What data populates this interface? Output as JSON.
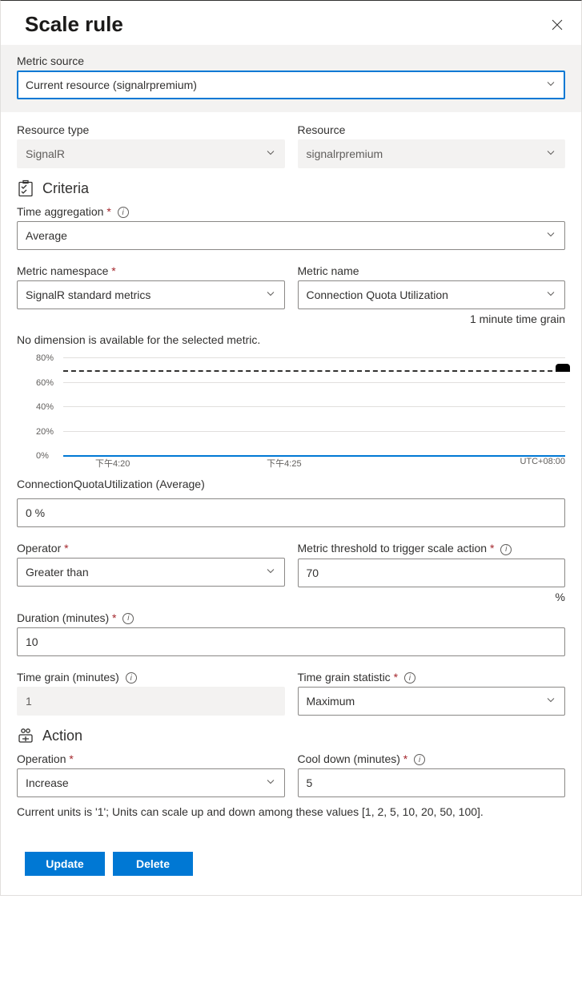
{
  "title": "Scale rule",
  "metric_source": {
    "label": "Metric source",
    "value": "Current resource (signalrpremium)"
  },
  "resource_type": {
    "label": "Resource type",
    "value": "SignalR"
  },
  "resource": {
    "label": "Resource",
    "value": "signalrpremium"
  },
  "criteria": {
    "title": "Criteria"
  },
  "time_aggregation": {
    "label": "Time aggregation",
    "value": "Average"
  },
  "metric_namespace": {
    "label": "Metric namespace",
    "value": "SignalR standard metrics"
  },
  "metric_name": {
    "label": "Metric name",
    "value": "Connection Quota Utilization",
    "grain_note": "1 minute time grain"
  },
  "dimension_note": "No dimension is available for the selected metric.",
  "chart_data": {
    "type": "line",
    "title": "",
    "ylabel": "",
    "ylim": [
      0,
      80
    ],
    "y_ticks": [
      "0%",
      "20%",
      "40%",
      "60%",
      "80%"
    ],
    "x_ticks": [
      "下午4:20",
      "下午4:25",
      "UTC+08:00"
    ],
    "threshold": 70,
    "series": [
      {
        "name": "ConnectionQuotaUtilization (Average)",
        "values": [
          0,
          0,
          0,
          0,
          0,
          0,
          0,
          0,
          0,
          0
        ]
      }
    ]
  },
  "chart_legend": "ConnectionQuotaUtilization (Average)",
  "current_value": {
    "value": "0 %"
  },
  "operator": {
    "label": "Operator",
    "value": "Greater than"
  },
  "threshold": {
    "label": "Metric threshold to trigger scale action",
    "value": "70",
    "unit": "%"
  },
  "duration": {
    "label": "Duration (minutes)",
    "value": "10"
  },
  "time_grain": {
    "label": "Time grain (minutes)",
    "value": "1"
  },
  "time_grain_stat": {
    "label": "Time grain statistic",
    "value": "Maximum"
  },
  "action": {
    "title": "Action"
  },
  "operation": {
    "label": "Operation",
    "value": "Increase"
  },
  "cooldown": {
    "label": "Cool down (minutes)",
    "value": "5"
  },
  "units_note": "Current units is '1'; Units can scale up and down among these values [1, 2, 5, 10, 20, 50, 100].",
  "buttons": {
    "update": "Update",
    "delete": "Delete"
  }
}
